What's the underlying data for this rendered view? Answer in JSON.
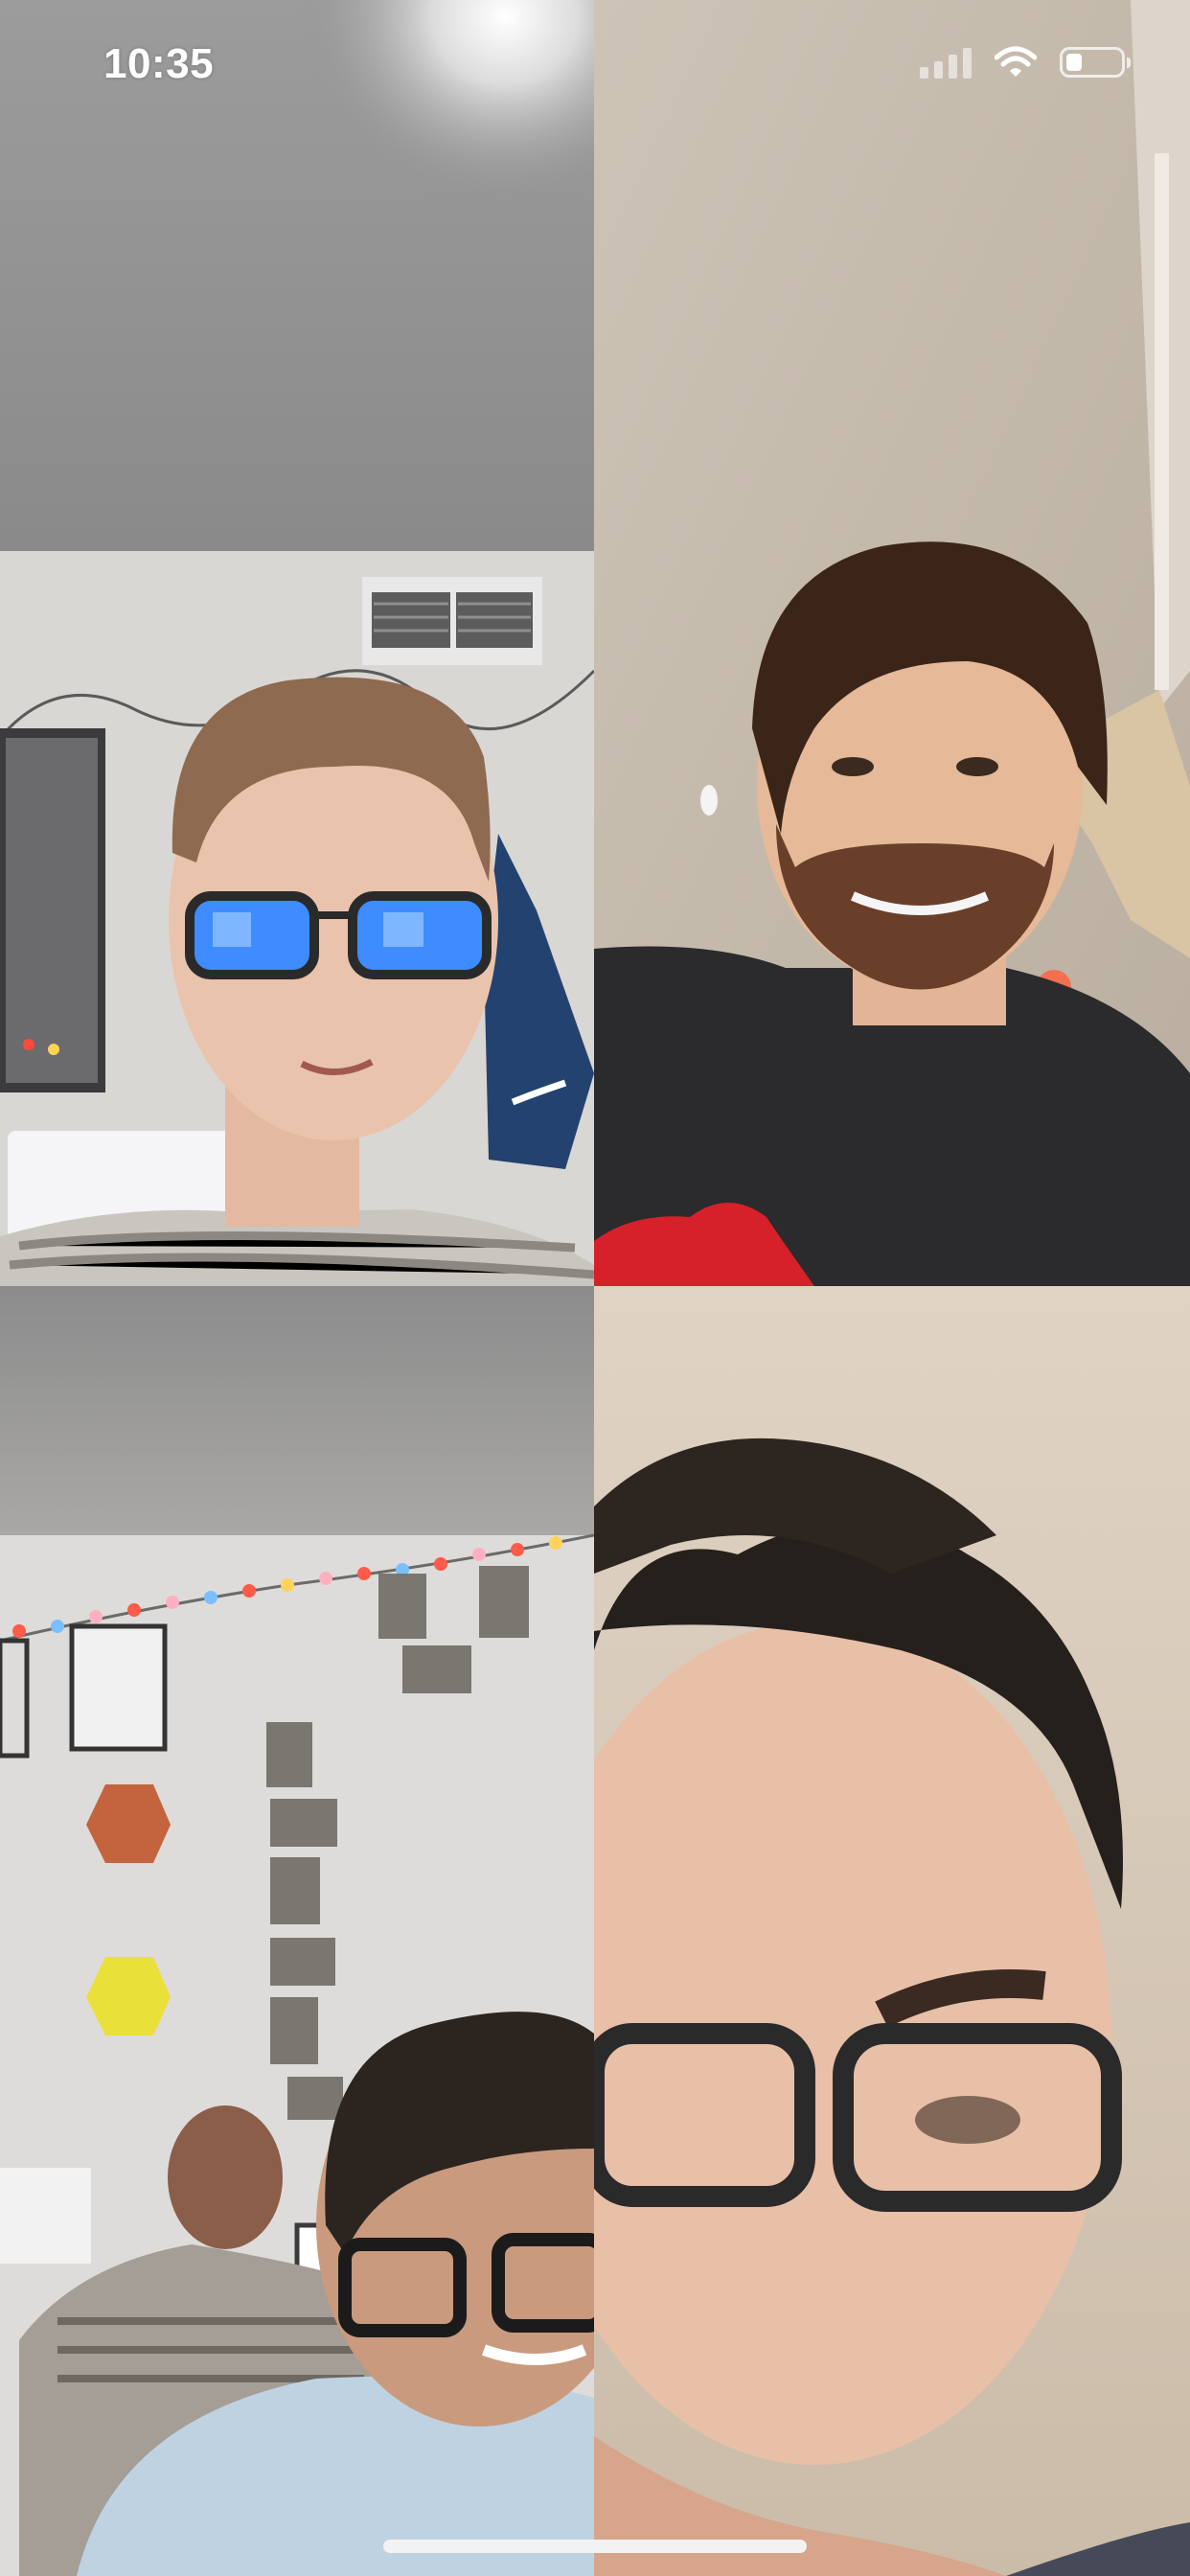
{
  "status_bar": {
    "time": "10:35",
    "signal_icon": "cellular-signal-icon",
    "wifi_icon": "wifi-icon",
    "battery_icon": "battery-icon",
    "battery_level": 0.3
  },
  "call": {
    "type": "group-video-call",
    "participants": [
      {
        "tile": "top-left",
        "description_icon": "participant-video-feed"
      },
      {
        "tile": "top-right",
        "description_icon": "participant-video-feed"
      },
      {
        "tile": "bottom-left",
        "description_icon": "participant-video-feed"
      },
      {
        "tile": "bottom-right",
        "description_icon": "participant-video-feed"
      }
    ]
  },
  "home_indicator": "home-indicator-bar"
}
